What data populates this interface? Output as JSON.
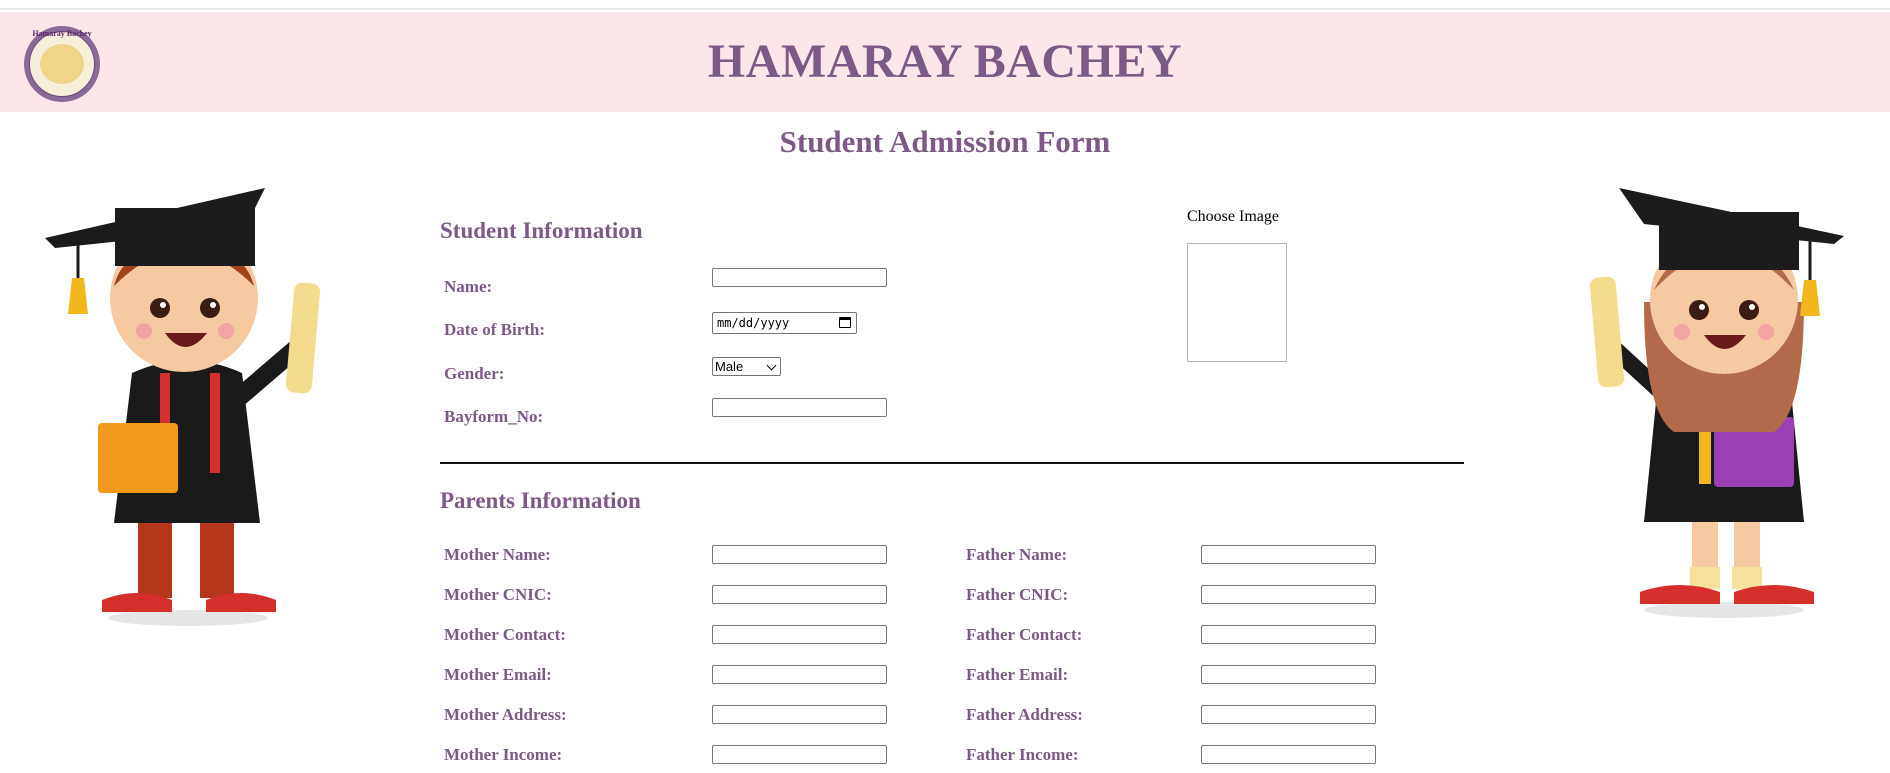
{
  "header": {
    "logo_text": "Hamaray Bachey",
    "site_title": "HAMARAY BACHEY"
  },
  "form_title": "Student Admission Form",
  "student_section": {
    "title": "Student Information",
    "name_label": "Name:",
    "name_value": "",
    "dob_label": "Date of Birth:",
    "dob_placeholder": "mm/dd/yyyy",
    "gender_label": "Gender:",
    "gender_value": "Male",
    "bayform_label": "Bayform_No:",
    "bayform_value": "",
    "choose_image_label": "Choose Image"
  },
  "parents_section": {
    "title": "Parents Information",
    "mother_labels": [
      "Mother Name:",
      "Mother CNIC:",
      "Mother Contact:",
      "Mother Email:",
      "Mother Address:",
      "Mother Income:"
    ],
    "father_labels": [
      "Father Name:",
      "Father CNIC:",
      "Father Contact:",
      "Father Email:",
      "Father Address:",
      "Father Income:"
    ]
  },
  "colors": {
    "accent": "#7d5a86",
    "header_bg": "#fbe6e9"
  }
}
